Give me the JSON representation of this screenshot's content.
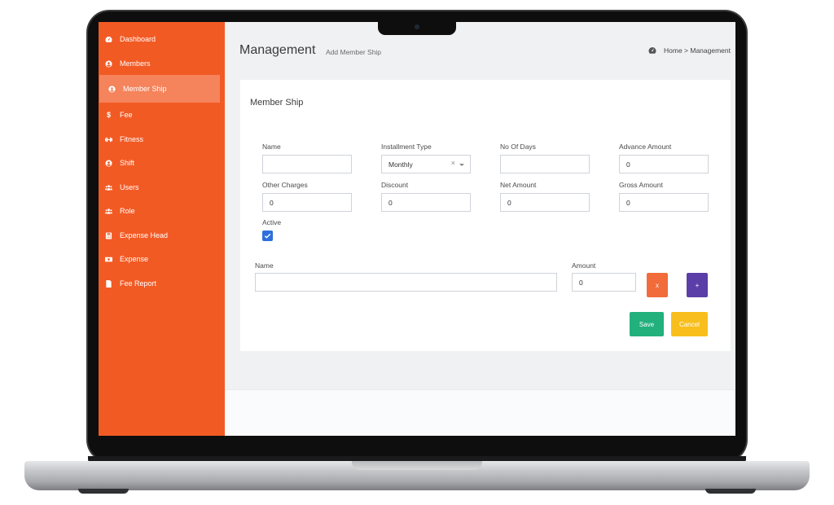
{
  "sidebar": {
    "items": [
      {
        "label": "Dashboard",
        "icon": "dashboard-icon"
      },
      {
        "label": "Members",
        "icon": "user-circle-icon"
      },
      {
        "label": "Member Ship",
        "icon": "user-circle-icon",
        "active": true
      },
      {
        "label": "Fee",
        "icon": "dollar-icon"
      },
      {
        "label": "Fitness",
        "icon": "dumbbell-icon"
      },
      {
        "label": "Shift",
        "icon": "user-circle-icon"
      },
      {
        "label": "Users",
        "icon": "users-icon"
      },
      {
        "label": "Role",
        "icon": "users-icon"
      },
      {
        "label": "Expense Head",
        "icon": "calculator-icon"
      },
      {
        "label": "Expense",
        "icon": "money-bill-icon"
      },
      {
        "label": "Fee Report",
        "icon": "file-icon"
      }
    ]
  },
  "header": {
    "title": "Management",
    "subtitle": "Add Member Ship",
    "breadcrumb": "Home > Management"
  },
  "form": {
    "title": "Member Ship",
    "name": {
      "label": "Name",
      "value": ""
    },
    "installment_type": {
      "label": "Installment Type",
      "value": "Monthly"
    },
    "no_of_days": {
      "label": "No Of Days",
      "value": ""
    },
    "advance_amount": {
      "label": "Advance Amount",
      "value": "0"
    },
    "other_charges": {
      "label": "Other Charges",
      "value": "0"
    },
    "discount": {
      "label": "Discount",
      "value": "0"
    },
    "net_amount": {
      "label": "Net Amount",
      "value": "0"
    },
    "gross_amount": {
      "label": "Gross Amount",
      "value": "0"
    },
    "active": {
      "label": "Active",
      "checked": true
    },
    "line_name": {
      "label": "Name",
      "value": ""
    },
    "line_amount": {
      "label": "Amount",
      "value": "0"
    },
    "remove_label": "x",
    "add_label": "+",
    "save_label": "Save",
    "cancel_label": "Cancel"
  },
  "colors": {
    "sidebar": "#f25a24",
    "remove_button": "#f26b3a",
    "add_button": "#5b3ea8",
    "save_button": "#22b07d",
    "cancel_button": "#f8bf1c",
    "checkbox": "#2f6fdc"
  }
}
